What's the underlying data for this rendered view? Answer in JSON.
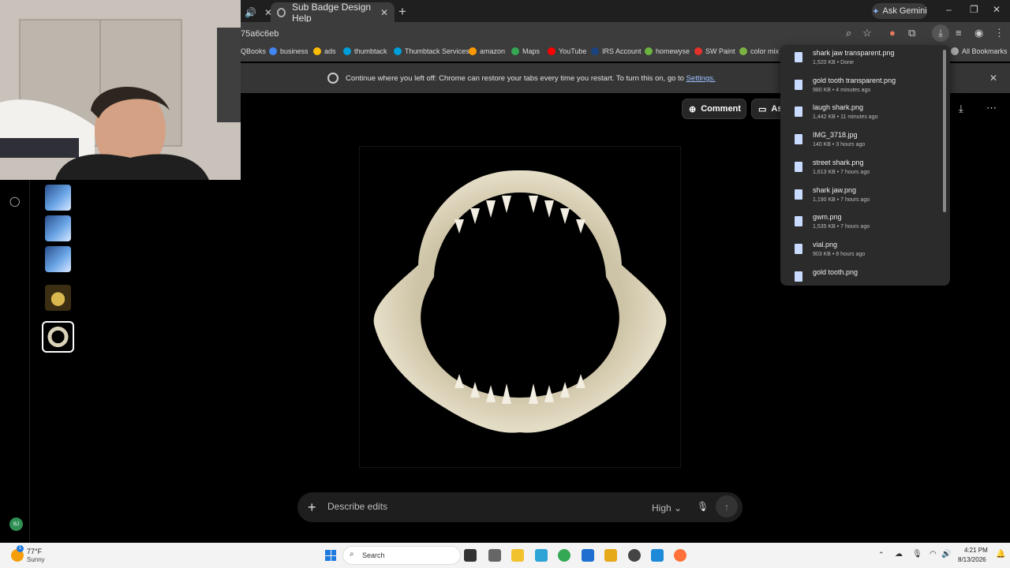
{
  "browser": {
    "active_tab_title": "Sub Badge Design Help",
    "new_tab_symbol": "+",
    "ask_gemini_label": "Ask Gemini",
    "url_fragment": "75a6c6eb",
    "window_controls": [
      "–",
      "❐",
      "✕"
    ]
  },
  "bookmarks": [
    {
      "label": "QBooks",
      "color": "#2ca01c"
    },
    {
      "label": "business",
      "color": "#4285f4"
    },
    {
      "label": "ads",
      "color": "#fbbc04"
    },
    {
      "label": "thumbtack",
      "color": "#009fd9"
    },
    {
      "label": "Thumbtack Services",
      "color": "#009fd9"
    },
    {
      "label": "amazon",
      "color": "#ff9900"
    },
    {
      "label": "Maps",
      "color": "#34a853"
    },
    {
      "label": "YouTube",
      "color": "#ff0000"
    },
    {
      "label": "IRS Account",
      "color": "#1a4480"
    },
    {
      "label": "homewyse",
      "color": "#6cb33f"
    },
    {
      "label": "SW Paint",
      "color": "#e4312b"
    },
    {
      "label": "color mix",
      "color": "#7cb342"
    },
    {
      "label": "All Bookmarks",
      "color": "#aaaaaa"
    }
  ],
  "restore_bar": {
    "message": "Continue where you left off: Chrome can restore your tabs every time you restart. To turn this on, go to",
    "link": "Settings."
  },
  "app": {
    "comment_label": "Comment",
    "ask_label": "As",
    "prompt_placeholder": "Describe edits",
    "quality": "High",
    "avatar_initials": "BJ"
  },
  "downloads": [
    {
      "name": "shark jaw transparent.png",
      "meta": "1,520 KB • Done"
    },
    {
      "name": "gold tooth transparent.png",
      "meta": "980 KB • 4 minutes ago"
    },
    {
      "name": "laugh shark.png",
      "meta": "1,442 KB • 11 minutes ago"
    },
    {
      "name": "IMG_3718.jpg",
      "meta": "140 KB • 3 hours ago"
    },
    {
      "name": "street shark.png",
      "meta": "1,613 KB • 7 hours ago"
    },
    {
      "name": "shark jaw.png",
      "meta": "1,190 KB • 7 hours ago"
    },
    {
      "name": "gwm.png",
      "meta": "1,535 KB • 7 hours ago"
    },
    {
      "name": "vial.png",
      "meta": "903 KB • 8 hours ago"
    },
    {
      "name": "gold tooth.png",
      "meta": ""
    }
  ],
  "taskbar": {
    "weather_temp": "77°F",
    "weather_desc": "Sunny",
    "notification_count": "1",
    "search_label": "Search",
    "time": "4:21 PM",
    "date": "8/13/2026"
  }
}
